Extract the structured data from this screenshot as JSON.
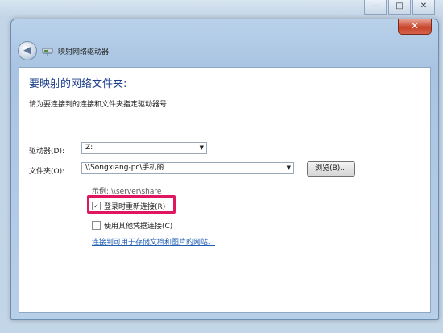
{
  "window": {
    "title": "映射网络驱动器",
    "close_glyph": "✕"
  },
  "background_window": {
    "minimize_glyph": "—",
    "maximize_glyph": "□",
    "close_glyph": "✕"
  },
  "nav": {
    "back_glyph": "◀"
  },
  "content": {
    "heading": "要映射的网络文件夹:",
    "instruction": "请为要连接到的连接和文件夹指定驱动器号:",
    "drive_label": "驱动器(D):",
    "drive_value": "Z:",
    "folder_label": "文件夹(O):",
    "folder_value": "\\\\Songxiang-pc\\手机丽",
    "browse_label": "浏览(B)...",
    "example": "示例: \\\\server\\share",
    "reconnect_label": "登录时重新连接(R)",
    "reconnect_checked": "✓",
    "other_credentials_label": "使用其他凭据连接(C)",
    "link_text": "连接到可用于存储文档和图片的网站。"
  },
  "icons": {
    "back": "back-arrow-icon",
    "network_drive": "network-drive-icon",
    "dropdown": "chevron-down-icon"
  },
  "colors": {
    "heading": "#1e3f8b",
    "link": "#1f5db3",
    "highlight": "#e0165e",
    "close_button": "#c7442a"
  }
}
